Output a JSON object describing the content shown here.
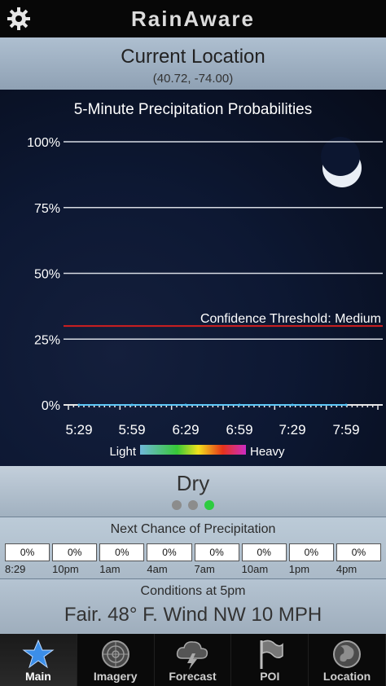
{
  "app": {
    "brand": "RainAware"
  },
  "location": {
    "title": "Current Location",
    "coords": "(40.72, -74.00)"
  },
  "chart_data": {
    "type": "line",
    "title": "5-Minute Precipitation Probabilities",
    "x_ticks": [
      "5:29",
      "5:59",
      "6:29",
      "6:59",
      "7:29",
      "7:59"
    ],
    "y_ticks": [
      "100%",
      "75%",
      "50%",
      "25%",
      "0%"
    ],
    "ylim": [
      0,
      100
    ],
    "threshold": {
      "label": "Confidence Threshold: Medium",
      "value": 30,
      "color": "#d11f1f"
    },
    "series": [
      {
        "values": [
          0,
          0,
          0,
          0,
          0,
          0
        ]
      }
    ],
    "legend": {
      "light": "Light",
      "heavy": "Heavy"
    },
    "grid": true
  },
  "status": {
    "text": "Dry",
    "dots": [
      false,
      false,
      true
    ],
    "dot_active_color": "#2ecc40"
  },
  "next_chance": {
    "heading": "Next Chance of Precipitation",
    "cells": [
      "0%",
      "0%",
      "0%",
      "0%",
      "0%",
      "0%",
      "0%",
      "0%"
    ],
    "times": [
      "8:29",
      "10pm",
      "1am",
      "4am",
      "7am",
      "10am",
      "1pm",
      "4pm"
    ]
  },
  "conditions": {
    "label": "Conditions at 5pm",
    "value": "Fair. 48° F.  Wind NW 10 MPH"
  },
  "nav": {
    "tabs": [
      {
        "label": "Main",
        "icon": "star-icon",
        "active": true
      },
      {
        "label": "Imagery",
        "icon": "radar-icon",
        "active": false
      },
      {
        "label": "Forecast",
        "icon": "storm-cloud-icon",
        "active": false
      },
      {
        "label": "POI",
        "icon": "flag-icon",
        "active": false
      },
      {
        "label": "Location",
        "icon": "globe-icon",
        "active": false
      }
    ]
  }
}
